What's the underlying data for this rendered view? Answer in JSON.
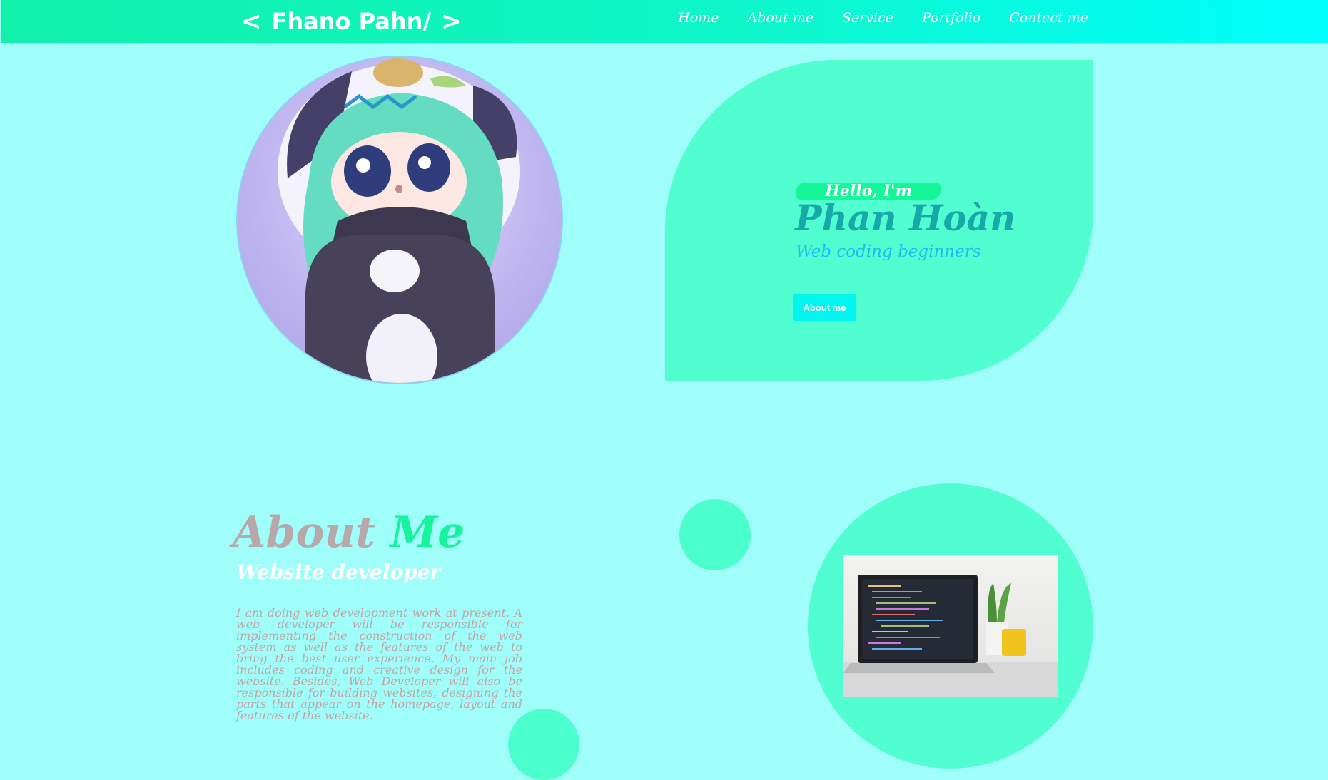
{
  "header": {
    "brand": "Fhano Pahn/",
    "nav": [
      "Home",
      "About me",
      "Service",
      "Portfolio",
      "Contact me"
    ]
  },
  "hero": {
    "greeting": "Hello, I'm",
    "name": "Phan Hoàn",
    "subtitle": "Web coding beginners",
    "button": "About me"
  },
  "about": {
    "title_part1": "About",
    "title_part2": "Me",
    "subtitle": "Website developer",
    "description": "I am doing web development work at present. A web developer will be responsible for implementing the construction of the web system as well as the features of the web to bring the best user experience. My main job includes coding and creative design for the website. Besides, Web Developer will also be responsible for building websites, designing the parts that appear on the homepage, layout and features of the website."
  },
  "colors": {
    "page_bg": "#a0fefa",
    "accent_green": "#15f49c",
    "leaf_green": "#51fed0",
    "cyan": "#00f5ee"
  }
}
